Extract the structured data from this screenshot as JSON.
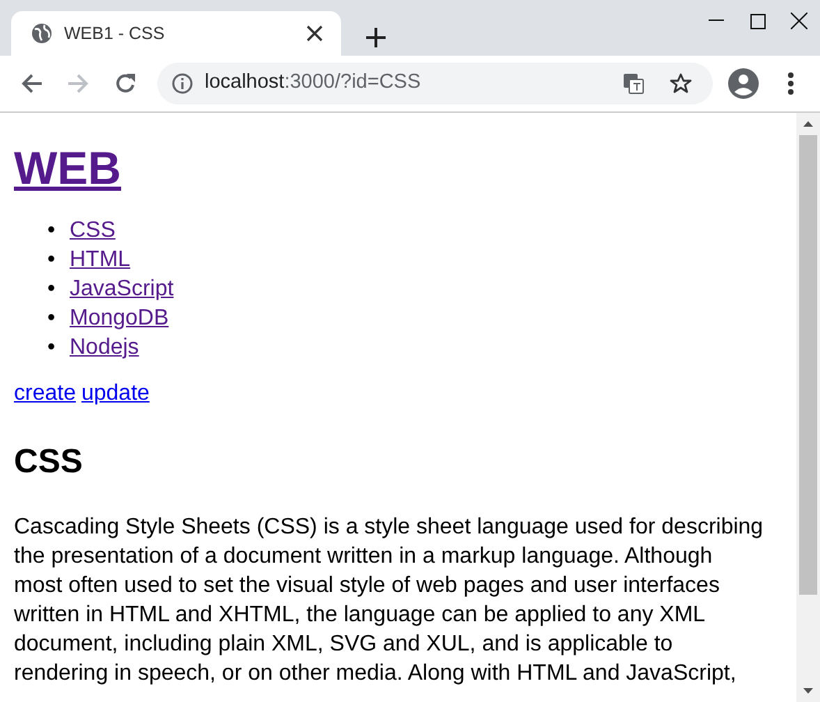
{
  "window": {
    "tab_title": "WEB1 - CSS"
  },
  "toolbar": {
    "back": {
      "disabled": false
    },
    "forward": {
      "disabled": true
    },
    "address": {
      "host": "localhost",
      "rest": ":3000/?id=CSS"
    }
  },
  "page": {
    "heading": {
      "text": "WEB",
      "visited": true
    },
    "links": [
      {
        "marker": "•",
        "text": "CSS",
        "visited": true
      },
      {
        "marker": "•",
        "text": "HTML",
        "visited": true
      },
      {
        "marker": "•",
        "text": "JavaScript",
        "visited": true
      },
      {
        "marker": "•",
        "text": "MongoDB",
        "visited": true
      },
      {
        "marker": "•",
        "text": "Nodejs",
        "visited": true
      }
    ],
    "actions": [
      {
        "text": "create",
        "visited": false
      },
      {
        "text": "update",
        "visited": false
      }
    ],
    "title": "CSS",
    "body": "Cascading Style Sheets (CSS) is a style sheet language used for describing the presentation of a document written in a markup language. Although most often used to set the visual style of web pages and user interfaces written in HTML and XHTML, the language can be applied to any XML document, including plain XML, SVG and XUL, and is applicable to rendering in speech, or on other media. Along with HTML and JavaScript,"
  }
}
